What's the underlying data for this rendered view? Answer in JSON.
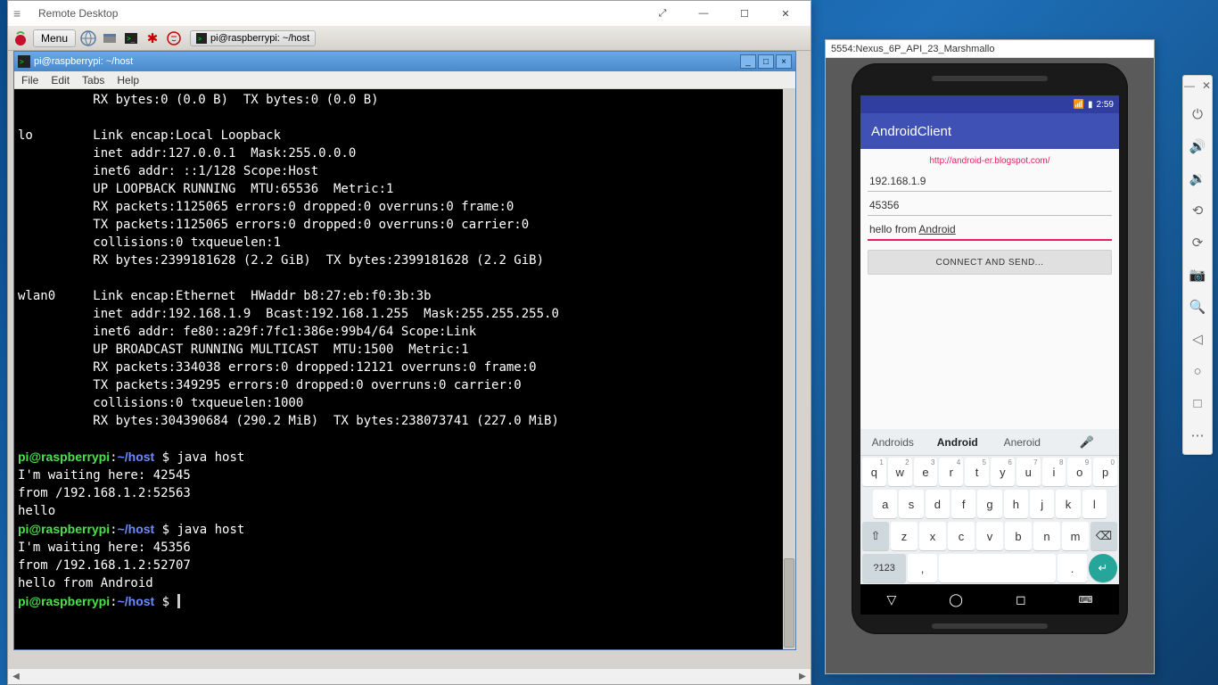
{
  "rd_window": {
    "title": "Remote Desktop",
    "menu_label": "Menu",
    "taskbar_task": "pi@raspberrypi: ~/host"
  },
  "terminal": {
    "title": "pi@raspberrypi: ~/host",
    "menu": [
      "File",
      "Edit",
      "Tabs",
      "Help"
    ],
    "lines": [
      {
        "t": "          RX bytes:0 (0.0 B)  TX bytes:0 (0.0 B)"
      },
      {
        "t": ""
      },
      {
        "t": "lo        Link encap:Local Loopback"
      },
      {
        "t": "          inet addr:127.0.0.1  Mask:255.0.0.0"
      },
      {
        "t": "          inet6 addr: ::1/128 Scope:Host"
      },
      {
        "t": "          UP LOOPBACK RUNNING  MTU:65536  Metric:1"
      },
      {
        "t": "          RX packets:1125065 errors:0 dropped:0 overruns:0 frame:0"
      },
      {
        "t": "          TX packets:1125065 errors:0 dropped:0 overruns:0 carrier:0"
      },
      {
        "t": "          collisions:0 txqueuelen:1"
      },
      {
        "t": "          RX bytes:2399181628 (2.2 GiB)  TX bytes:2399181628 (2.2 GiB)"
      },
      {
        "t": ""
      },
      {
        "t": "wlan0     Link encap:Ethernet  HWaddr b8:27:eb:f0:3b:3b"
      },
      {
        "t": "          inet addr:192.168.1.9  Bcast:192.168.1.255  Mask:255.255.255.0"
      },
      {
        "t": "          inet6 addr: fe80::a29f:7fc1:386e:99b4/64 Scope:Link"
      },
      {
        "t": "          UP BROADCAST RUNNING MULTICAST  MTU:1500  Metric:1"
      },
      {
        "t": "          RX packets:334038 errors:0 dropped:12121 overruns:0 frame:0"
      },
      {
        "t": "          TX packets:349295 errors:0 dropped:0 overruns:0 carrier:0"
      },
      {
        "t": "          collisions:0 txqueuelen:1000"
      },
      {
        "t": "          RX bytes:304390684 (290.2 MiB)  TX bytes:238073741 (227.0 MiB)"
      },
      {
        "t": ""
      },
      {
        "prompt": true,
        "cmd": "java host"
      },
      {
        "t": "I'm waiting here: 42545"
      },
      {
        "t": "from /192.168.1.2:52563"
      },
      {
        "t": "hello"
      },
      {
        "prompt": true,
        "cmd": "java host"
      },
      {
        "t": "I'm waiting here: 45356"
      },
      {
        "t": "from /192.168.1.2:52707"
      },
      {
        "t": "hello from Android"
      },
      {
        "prompt": true,
        "cmd": ""
      }
    ],
    "prompt_user": "pi@raspberrypi",
    "prompt_path": "~/host",
    "prompt_sym": "$"
  },
  "emulator": {
    "title": "5554:Nexus_6P_API_23_Marshmallo",
    "status_time": "2:59",
    "app_title": "AndroidClient",
    "blog_link": "http://android-er.blogspot.com/",
    "ip_value": "192.168.1.9",
    "port_value": "45356",
    "msg_value_pre": "hello from ",
    "msg_value_u": "Android",
    "button_label": "CONNECT AND SEND...",
    "suggestions": [
      "Androids",
      "Android",
      "Aneroid"
    ],
    "row1": [
      [
        "q",
        "1"
      ],
      [
        "w",
        "2"
      ],
      [
        "e",
        "3"
      ],
      [
        "r",
        "4"
      ],
      [
        "t",
        "5"
      ],
      [
        "y",
        "6"
      ],
      [
        "u",
        "7"
      ],
      [
        "i",
        "8"
      ],
      [
        "o",
        "9"
      ],
      [
        "p",
        "0"
      ]
    ],
    "row2": [
      "a",
      "s",
      "d",
      "f",
      "g",
      "h",
      "j",
      "k",
      "l"
    ],
    "row3": [
      "z",
      "x",
      "c",
      "v",
      "b",
      "n",
      "m"
    ],
    "sym_key": "?123",
    "comma": ",",
    "period": "."
  }
}
